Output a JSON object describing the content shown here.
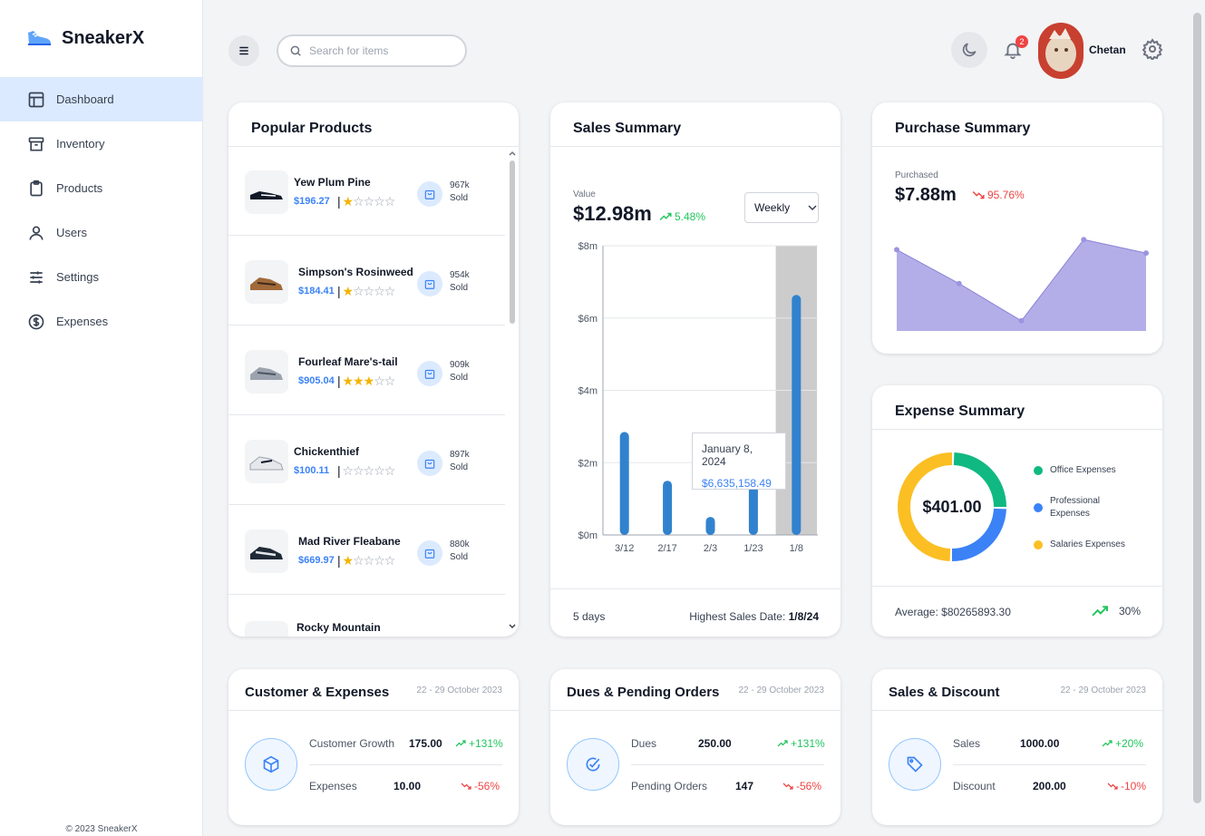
{
  "app": {
    "name": "SneakerX",
    "footer": "© 2023 SneakerX"
  },
  "sidebar": {
    "items": [
      {
        "label": "Dashboard",
        "icon": "layout-icon"
      },
      {
        "label": "Inventory",
        "icon": "archive-icon"
      },
      {
        "label": "Products",
        "icon": "clipboard-icon"
      },
      {
        "label": "Users",
        "icon": "user-icon"
      },
      {
        "label": "Settings",
        "icon": "sliders-icon"
      },
      {
        "label": "Expenses",
        "icon": "dollar-circle-icon"
      }
    ]
  },
  "header": {
    "search_placeholder": "Search for items",
    "notifications": "2",
    "user_name": "Chetan"
  },
  "popular": {
    "title": "Popular Products",
    "items": [
      {
        "name": "Yew Plum Pine",
        "price": "$196.27",
        "rating": 1,
        "sold": "967k",
        "sold_label": "Sold"
      },
      {
        "name": "Simpson's Rosinweed",
        "price": "$184.41",
        "rating": 1,
        "sold": "954k",
        "sold_label": "Sold"
      },
      {
        "name": "Fourleaf Mare's-tail",
        "price": "$905.04",
        "rating": 3,
        "sold": "909k",
        "sold_label": "Sold"
      },
      {
        "name": "Chickenthief",
        "price": "$100.11",
        "rating": 0,
        "sold": "897k",
        "sold_label": "Sold"
      },
      {
        "name": "Mad River Fleabane",
        "price": "$669.97",
        "rating": 1,
        "sold": "880k",
        "sold_label": "Sold"
      },
      {
        "name": "Rocky Mountain",
        "price": "",
        "rating": 0,
        "sold": "",
        "sold_label": ""
      }
    ]
  },
  "sales": {
    "title": "Sales Summary",
    "value_label": "Value",
    "value": "$12.98m",
    "change": "5.48%",
    "period": "Weekly",
    "period_options": [
      "Weekly"
    ],
    "footer_left": "5 days",
    "footer_right_label": "Highest Sales Date:",
    "footer_right_value": "1/8/24",
    "tooltip_date": "January 8, 2024",
    "tooltip_value": "$6,635,158.49"
  },
  "purchase": {
    "title": "Purchase Summary",
    "label": "Purchased",
    "value": "$7.88m",
    "change": "95.76%"
  },
  "expense": {
    "title": "Expense Summary",
    "total": "$401.00",
    "legend": [
      {
        "label": "Office Expenses",
        "color": "#10b981"
      },
      {
        "label": "Professional Expenses",
        "color": "#3b82f6"
      },
      {
        "label": "Salaries Expenses",
        "color": "#fbbf24"
      }
    ],
    "average": "Average: $80265893.30",
    "growth": "30%"
  },
  "customer": {
    "title": "Customer & Expenses",
    "date": "22 - 29 October 2023",
    "rows": [
      {
        "label": "Customer Growth",
        "value": "175.00",
        "change": "+131%"
      },
      {
        "label": "Expenses",
        "value": "10.00",
        "change": "-56%"
      }
    ]
  },
  "dues": {
    "title": "Dues & Pending Orders",
    "date": "22 - 29 October 2023",
    "rows": [
      {
        "label": "Dues",
        "value": "250.00",
        "change": "+131%"
      },
      {
        "label": "Pending Orders",
        "value": "147",
        "change": "-56%"
      }
    ]
  },
  "discount": {
    "title": "Sales & Discount",
    "date": "22 - 29 October 2023",
    "rows": [
      {
        "label": "Sales",
        "value": "1000.00",
        "change": "+20%"
      },
      {
        "label": "Discount",
        "value": "200.00",
        "change": "-10%"
      }
    ]
  },
  "colors": {
    "accent": "#3b82f6",
    "up": "#22c55e",
    "down": "#ef4444",
    "area": "#b4aee8"
  },
  "chart_data": [
    {
      "type": "bar",
      "title": "",
      "categories": [
        "3/12",
        "2/17",
        "2/3",
        "1/23",
        "1/8"
      ],
      "values": [
        2.85,
        1.5,
        0.5,
        2.0,
        6.64
      ],
      "ylabel": "",
      "ylim": [
        0,
        8
      ],
      "yticks": [
        "$0m",
        "$2m",
        "$4m",
        "$6m",
        "$8m"
      ],
      "highlighted": "1/8"
    },
    {
      "type": "area",
      "title": "",
      "values": [
        2.4,
        1.4,
        0.3,
        2.7,
        2.3
      ]
    },
    {
      "type": "pie",
      "donut": true,
      "categories": [
        "Office Expenses",
        "Professional Expenses",
        "Salaries Expenses"
      ],
      "values": [
        25,
        25,
        50
      ]
    }
  ]
}
